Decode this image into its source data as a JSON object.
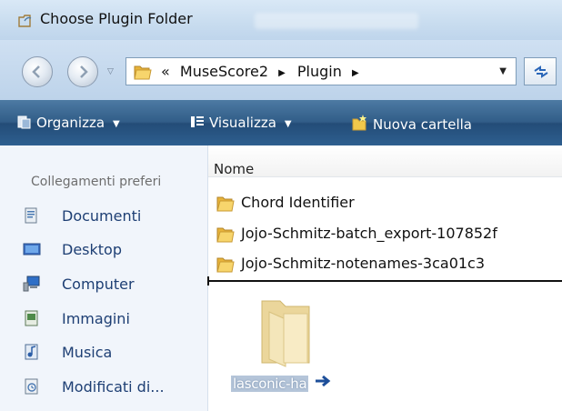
{
  "window": {
    "title": "Choose Plugin Folder"
  },
  "address_bar": {
    "chevron": "«",
    "crumbs": [
      "MuseScore2",
      "Plugin"
    ],
    "back_icon": "back-arrow-icon",
    "forward_icon": "forward-arrow-icon",
    "refresh_icon": "refresh-icon"
  },
  "toolbar": {
    "organize_label": "Organizza",
    "views_label": "Visualizza",
    "new_folder_label": "Nuova cartella"
  },
  "nav": {
    "header": "Collegamenti preferi",
    "items": [
      {
        "label": "Documenti",
        "icon": "documents-icon"
      },
      {
        "label": "Desktop",
        "icon": "desktop-icon"
      },
      {
        "label": "Computer",
        "icon": "computer-icon"
      },
      {
        "label": "Immagini",
        "icon": "pictures-icon"
      },
      {
        "label": "Musica",
        "icon": "music-icon"
      },
      {
        "label": "Modificati di...",
        "icon": "recent-icon"
      }
    ]
  },
  "file_list": {
    "column_name": "Nome",
    "items": [
      {
        "name": "Chord Identifier",
        "icon": "folder-icon"
      },
      {
        "name": "Jojo-Schmitz-batch_export-107852f",
        "icon": "folder-icon"
      },
      {
        "name": "Jojo-Schmitz-notenames-3ca01c3",
        "icon": "folder-icon"
      }
    ]
  },
  "drag": {
    "label": "lasconic-ha",
    "icon": "folder-icon"
  },
  "colors": {
    "toolbar_bg": "#2e5f8f",
    "nav_text": "#1e3f74",
    "title_bg": "#c8dcef",
    "folder": "#f2c84b"
  }
}
